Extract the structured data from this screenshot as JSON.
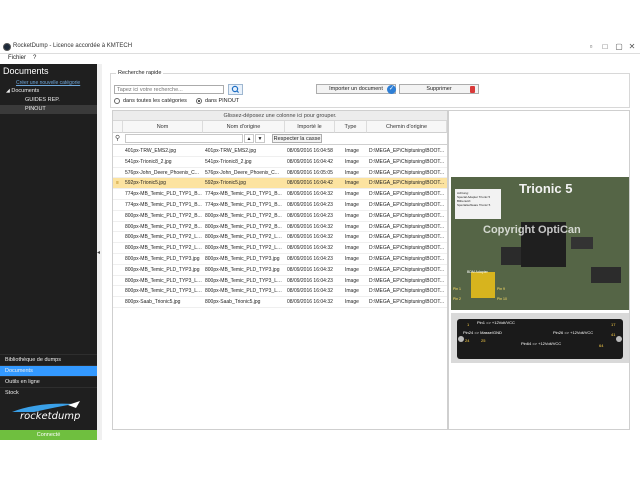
{
  "window": {
    "title": "RocketDump - Licence accordée à KMTECH"
  },
  "menu": {
    "file": "Fichier",
    "help": "?"
  },
  "sidebar": {
    "heading": "Documents",
    "new_category": "Créer une nouvelle catégorie",
    "tree_root": "Documents",
    "tree_items": [
      "GUIDES REP.",
      "PINOUT"
    ],
    "bottom_items": [
      "Bibliothèque de dumps",
      "Documents",
      "Outils en ligne",
      "Stock"
    ],
    "logo_text": "rocketdump",
    "status": "Connecté"
  },
  "search": {
    "group_label": "Recherche rapide",
    "placeholder": "Tapez ici votre recherche...",
    "import_label": "Importer un document",
    "delete_label": "Supprimer",
    "radio_all": "dans toutes les catégories",
    "radio_current": "dans PINOUT",
    "selected_radio": "current"
  },
  "grid": {
    "group_hint": "Glissez-déposez une colonne ici pour grouper.",
    "columns": [
      "Nom",
      "Nom d'origine",
      "Importé le",
      "Type",
      "Chemin d'origine"
    ],
    "match_case": "Respecter la casse",
    "selected_row": 3,
    "rows": [
      [
        "401px-TRW_EMS2.jpg",
        "401px-TRW_EMS2.jpg",
        "08/09/2016 16:04:58",
        "Image",
        "D:\\MEGA_EP\\Chiptuning\\BOOT..."
      ],
      [
        "541px-Trionic8_2.jpg",
        "541px-Trionic8_2.jpg",
        "08/09/2016 16:04:42",
        "Image",
        "D:\\MEGA_EP\\Chiptuning\\BOOT..."
      ],
      [
        "576px-John_Deere_Phoenix_C...",
        "576px-John_Deere_Phoenix_C...",
        "08/09/2016 16:05:05",
        "Image",
        "D:\\MEGA_EP\\Chiptuning\\BOOT..."
      ],
      [
        "592px-Trionic5.jpg",
        "592px-Trionic5.jpg",
        "08/09/2016 16:04:42",
        "Image",
        "D:\\MEGA_EP\\Chiptuning\\BOOT..."
      ],
      [
        "774px-MB_Temic_PLD_TYP1_B...",
        "774px-MB_Temic_PLD_TYP1_B...",
        "08/09/2016 16:04:32",
        "Image",
        "D:\\MEGA_EP\\Chiptuning\\BOOT..."
      ],
      [
        "774px-MB_Temic_PLD_TYP1_B...",
        "774px-MB_Temic_PLD_TYP1_B...",
        "08/09/2016 16:04:23",
        "Image",
        "D:\\MEGA_EP\\Chiptuning\\BOOT..."
      ],
      [
        "800px-MB_Temic_PLD_TYP2_B...",
        "800px-MB_Temic_PLD_TYP2_B...",
        "08/09/2016 16:04:23",
        "Image",
        "D:\\MEGA_EP\\Chiptuning\\BOOT..."
      ],
      [
        "800px-MB_Temic_PLD_TYP2_B...",
        "800px-MB_Temic_PLD_TYP2_B...",
        "08/09/2016 16:04:32",
        "Image",
        "D:\\MEGA_EP\\Chiptuning\\BOOT..."
      ],
      [
        "800px-MB_Temic_PLD_TYP2_La...",
        "800px-MB_Temic_PLD_TYP2_La...",
        "08/09/2016 16:04:32",
        "Image",
        "D:\\MEGA_EP\\Chiptuning\\BOOT..."
      ],
      [
        "800px-MB_Temic_PLD_TYP2_La...",
        "800px-MB_Temic_PLD_TYP2_La...",
        "08/09/2016 16:04:32",
        "Image",
        "D:\\MEGA_EP\\Chiptuning\\BOOT..."
      ],
      [
        "800px-MB_Temic_PLD_TYP3.jpg",
        "800px-MB_Temic_PLD_TYP3.jpg",
        "08/09/2016 16:04:23",
        "Image",
        "D:\\MEGA_EP\\Chiptuning\\BOOT..."
      ],
      [
        "800px-MB_Temic_PLD_TYP3.jpg",
        "800px-MB_Temic_PLD_TYP3.jpg",
        "08/09/2016 16:04:32",
        "Image",
        "D:\\MEGA_EP\\Chiptuning\\BOOT..."
      ],
      [
        "800px-MB_Temic_PLD_TYP3_La...",
        "800px-MB_Temic_PLD_TYP3_La...",
        "08/09/2016 16:04:23",
        "Image",
        "D:\\MEGA_EP\\Chiptuning\\BOOT..."
      ],
      [
        "800px-MB_Temic_PLD_TYP3_La...",
        "800px-MB_Temic_PLD_TYP3_La...",
        "08/09/2016 16:04:32",
        "Image",
        "D:\\MEGA_EP\\Chiptuning\\BOOT..."
      ],
      [
        "800px-Saab_Trionic5.jpg",
        "800px-Saab_Trionic5.jpg",
        "08/09/2016 16:04:32",
        "Image",
        "D:\\MEGA_EP\\Chiptuning\\BOOT..."
      ]
    ]
  },
  "preview": {
    "title": "Trionic 5",
    "watermark": "Copyright OptiCan",
    "info_lines": [
      "Achtung:",
      "Special Adapter Trionic 5",
      "Bitbenutzt:",
      "Spezialsoftware Trionic 5"
    ],
    "adapter_label": "BDM Adapter",
    "pin_labels": [
      "Pin 1",
      "Pin 2",
      "Pin 9",
      "Pin 10"
    ],
    "connector_labels": [
      "Pin1 => +12Volt/VCC",
      "Pin24 => Masse/GND",
      "Pin26 => +12Volt/VCC",
      "Pin64 => +12Volt/VCC"
    ],
    "connector_numbers": [
      "1",
      "24",
      "25",
      "64",
      "17",
      "41"
    ]
  },
  "colors": {
    "accent": "#3399ff",
    "sidebar": "#1f1f1f",
    "selection": "#fce3a0",
    "connected": "#6fbf3f"
  }
}
